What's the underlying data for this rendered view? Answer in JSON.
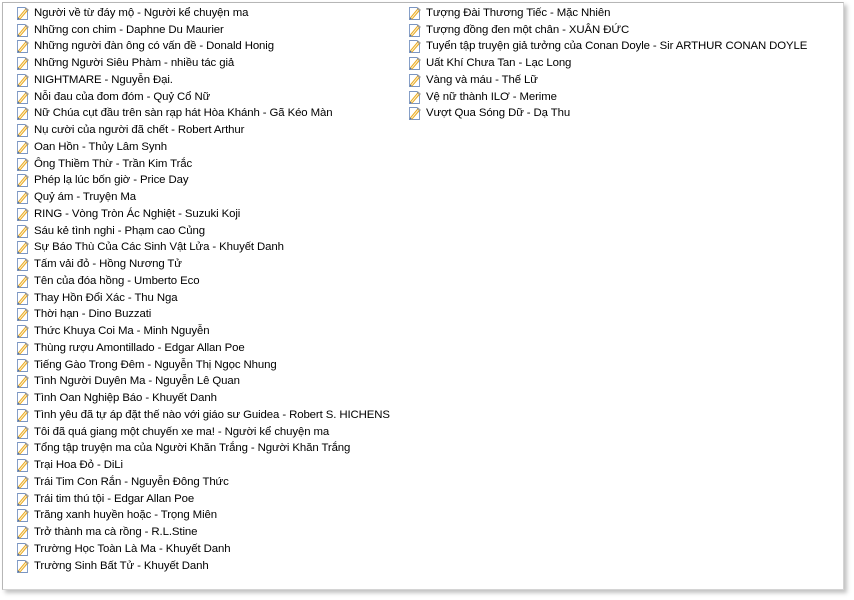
{
  "window": {
    "name": "file-list-window",
    "background_color": "#ffffff",
    "border_color": "#b6b6b6",
    "shadow_color": "#787878"
  },
  "icon": {
    "semantic_name": "wordpad-document-icon",
    "page_color": "#ffffff",
    "page_border_color": "#7a95c2",
    "pencil_body_color": "#f0c04a",
    "pencil_stripe_color": "#e8a317",
    "pencil_tip_color": "#c0c0c0",
    "accent_color": "#4a6fa5"
  },
  "columns": [
    {
      "id": "column-left",
      "items": [
        {
          "label": "Người về từ đáy mộ - Người kể chuyện ma"
        },
        {
          "label": "Những con chim - Daphne Du Maurier"
        },
        {
          "label": "Những người đàn ông có vấn đề - Donald Honig"
        },
        {
          "label": "Những Người Siêu Phàm - nhiều tác giả"
        },
        {
          "label": "NIGHTMARE - Nguyễn Đại."
        },
        {
          "label": "Nỗi đau của đom đóm - Quỷ Cổ Nữ"
        },
        {
          "label": "Nữ Chúa cụt đầu trên sàn rạp hát Hòa Khánh - Gã Kéo Màn"
        },
        {
          "label": "Nụ cười của người đã chết - Robert Arthur"
        },
        {
          "label": "Oan Hồn - Thủy Lâm Synh"
        },
        {
          "label": "Ông Thiềm Thừ - Trần Kim Trắc"
        },
        {
          "label": "Phép lạ lúc bốn giờ - Price Day"
        },
        {
          "label": "Quỷ ám - Truyện Ma"
        },
        {
          "label": "RING - Vòng Tròn Ác Nghiệt - Suzuki Koji"
        },
        {
          "label": "Sáu kẻ tình nghi - Phạm cao Củng"
        },
        {
          "label": "Sự Báo Thù Của Các Sinh Vật Lửa - Khuyết Danh"
        },
        {
          "label": "Tấm vải đỏ - Hồng Nương Tử"
        },
        {
          "label": "Tên của đóa hồng - Umberto Eco"
        },
        {
          "label": "Thay Hồn Đổi Xác - Thu Nga"
        },
        {
          "label": "Thời hạn - Dino Buzzati"
        },
        {
          "label": "Thức Khuya Coi Ma - Minh Nguyễn"
        },
        {
          "label": "Thùng rượu Amontillado - Edgar Allan Poe"
        },
        {
          "label": "Tiếng Gào Trong Đêm - Nguyễn Thị Ngọc Nhung"
        },
        {
          "label": "Tình Người Duyên Ma - Nguyễn Lê Quan"
        },
        {
          "label": "Tình Oan Nghiệp Báo - Khuyết Danh"
        },
        {
          "label": "Tình yêu đã tự áp đặt thế nào với giáo sư Guidea - Robert S. HICHENS"
        },
        {
          "label": "Tôi đã quá giang một chuyến xe ma! - Người kể chuyện ma"
        },
        {
          "label": "Tổng tập truyện ma của Người Khăn Trắng - Người Khăn Trắng"
        },
        {
          "label": "Trại Hoa Đỏ - DiLi"
        },
        {
          "label": "Trái Tim Con Rắn - Nguyễn Đông Thức"
        },
        {
          "label": "Trái tim thú tội - Edgar Allan Poe"
        },
        {
          "label": "Trăng xanh huyền hoặc - Trọng Miên"
        },
        {
          "label": "Trở thành ma cà rồng - R.L.Stine"
        },
        {
          "label": "Trường Học Toàn Là Ma - Khuyết Danh"
        },
        {
          "label": "Trường Sinh Bất Tử - Khuyết Danh"
        }
      ]
    },
    {
      "id": "column-right",
      "items": [
        {
          "label": "Tượng Đài Thương Tiếc  - Mặc Nhiên"
        },
        {
          "label": "Tượng đồng đen một chân - XUÂN ĐỨC"
        },
        {
          "label": "Tuyển tập truyện giả tưởng của Conan Doyle - Sir ARTHUR CONAN DOYLE"
        },
        {
          "label": "Uất Khí Chưa Tan - Lạc Long"
        },
        {
          "label": "Vàng và máu - Thế Lữ"
        },
        {
          "label": "Vệ nữ thành ILƠ - Merime"
        },
        {
          "label": "Vượt Qua Sóng Dữ - Dạ Thu"
        }
      ]
    }
  ]
}
